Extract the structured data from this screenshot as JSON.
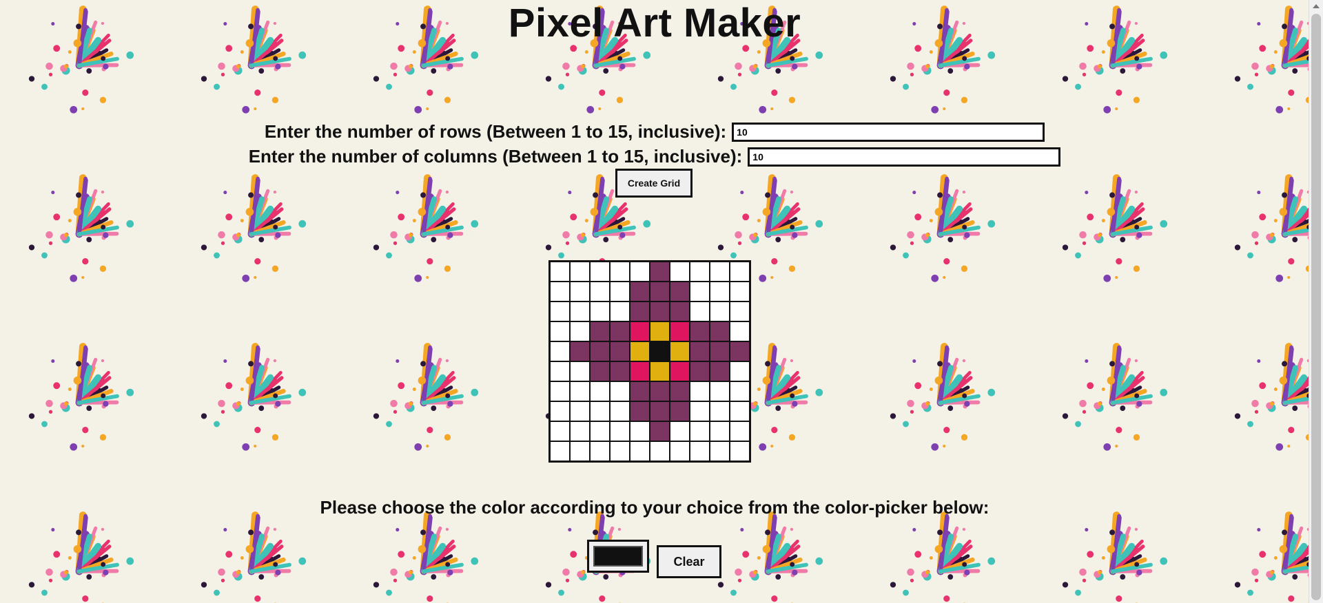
{
  "page": {
    "title": "Pixel Art Maker",
    "background": "#f4f1e6"
  },
  "form": {
    "rows_label": "Enter the number of rows (Between 1 to 15, inclusive):",
    "rows_value": "10",
    "cols_label": "Enter the number of columns (Between 1 to 15, inclusive):",
    "cols_value": "10",
    "create_button_label": "Create Grid"
  },
  "grid": {
    "rows": 10,
    "cols": 10,
    "palette": {
      "W": "#ffffff",
      "P": "#7b3560",
      "M": "#e0155f",
      "Y": "#e0b010",
      "K": "#111111"
    },
    "cells": [
      "WWWWWPWWWW",
      "WWWWPPPWWW",
      "WWWWPPPWWW",
      "WWPPMYMPPW",
      "WPPPYKYPPP",
      "WWPPMYMPPW",
      "WWWWPPPWWW",
      "WWWWPPPWWW",
      "WWWWWPWWWW",
      "WWWWWWWWWW"
    ]
  },
  "color_section": {
    "instruction": "Please choose the color according to your choice from the color-picker below:",
    "selected_color": "#111111",
    "clear_button_label": "Clear"
  },
  "splash_colors": [
    "#e8326e",
    "#f5a623",
    "#7e3fb0",
    "#3fc3b8",
    "#2b1838",
    "#f07aa8"
  ]
}
